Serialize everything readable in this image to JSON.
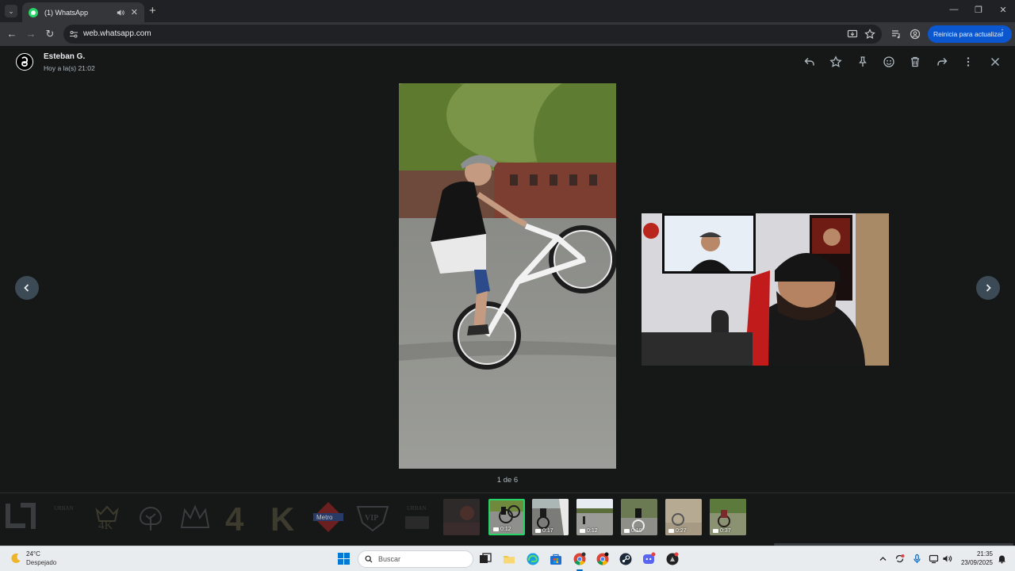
{
  "browser": {
    "tab_title": "(1) WhatsApp",
    "url": "web.whatsapp.com",
    "update_button": "Reinicia para actualizar"
  },
  "viewer": {
    "sender_name": "Esteban G.",
    "sender_time": "Hoy a la(s) 21:02",
    "counter": "1 de 6",
    "thumbnails": [
      {
        "kind": "sticker",
        "icon": "urban-logo-sticker"
      },
      {
        "kind": "sticker",
        "icon": "urban-text-sticker"
      },
      {
        "kind": "sticker",
        "icon": "4k-crown-sticker"
      },
      {
        "kind": "sticker",
        "icon": "tree-sticker"
      },
      {
        "kind": "sticker",
        "icon": "crown-sticker"
      },
      {
        "kind": "sticker",
        "icon": "4-sticker"
      },
      {
        "kind": "sticker",
        "icon": "k-sticker"
      },
      {
        "kind": "sticker",
        "icon": "metro-sticker"
      },
      {
        "kind": "sticker",
        "icon": "vip-badge-sticker"
      },
      {
        "kind": "sticker",
        "icon": "urban-dark-sticker"
      },
      {
        "kind": "image",
        "icon": "dark-photo"
      },
      {
        "kind": "video",
        "duration": "0:12",
        "selected": true
      },
      {
        "kind": "video",
        "duration": "0:17"
      },
      {
        "kind": "video",
        "duration": "0:12"
      },
      {
        "kind": "video",
        "duration": "0:19"
      },
      {
        "kind": "video",
        "duration": "0:27"
      },
      {
        "kind": "video",
        "duration": "0:37"
      }
    ]
  },
  "taskbar": {
    "weather_temp": "24°C",
    "weather_desc": "Despejado",
    "search_placeholder": "Buscar",
    "clock_time": "21:35",
    "clock_date": "23/09/2025"
  },
  "colors": {
    "accent_green": "#25d366",
    "viewer_bg": "#161717",
    "update_blue": "#0b57d0"
  }
}
